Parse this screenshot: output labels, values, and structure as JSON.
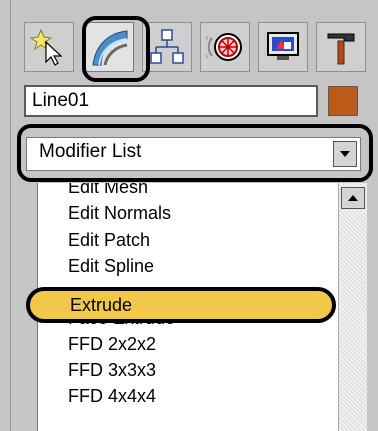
{
  "tabs": [
    {
      "name": "create",
      "icon": "star-pointer-icon"
    },
    {
      "name": "modify",
      "icon": "modify-curve-icon",
      "active": true
    },
    {
      "name": "hierarchy",
      "icon": "hierarchy-icon"
    },
    {
      "name": "motion",
      "icon": "motion-icon"
    },
    {
      "name": "display",
      "icon": "display-icon"
    },
    {
      "name": "utilities",
      "icon": "hammer-icon"
    }
  ],
  "object": {
    "name": "Line01",
    "color": "#bc5a1a"
  },
  "modifier_dropdown": {
    "selected": "Modifier List"
  },
  "modifier_list": {
    "items": [
      "Edit Mesh",
      "Edit Normals",
      "Edit Patch",
      "Edit Spline",
      "Extrude",
      "Face Extrude",
      "FFD 2x2x2",
      "FFD 3x3x3",
      "FFD 4x4x4"
    ],
    "highlighted": "Extrude"
  },
  "colors": {
    "highlight": "#f2c84b",
    "panel_bg": "#c5c5c5"
  }
}
